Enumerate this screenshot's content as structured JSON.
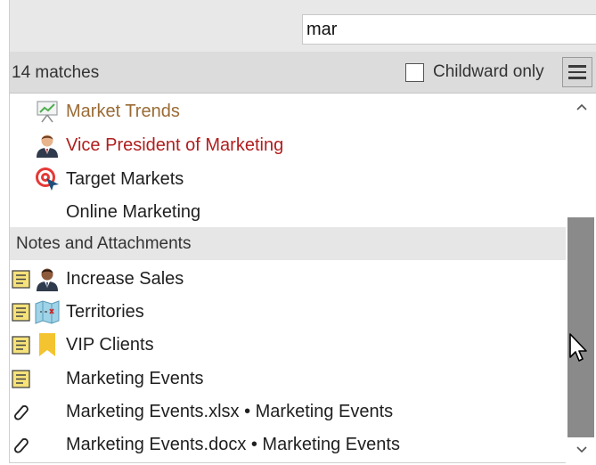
{
  "search": {
    "value": "mar"
  },
  "filter": {
    "matches": "14 matches",
    "childward_label": "Childward only",
    "childward_checked": false
  },
  "results": [
    {
      "label": "Market Trends",
      "color": "#9a6b35",
      "icon": "chart-presentation-icon"
    },
    {
      "label": "Vice President of Marketing",
      "color": "#b01e1e",
      "icon": "person-icon"
    },
    {
      "label": "Target Markets",
      "color": "#1f1f1f",
      "icon": "target-icon"
    },
    {
      "label": "Online Marketing",
      "color": "#1f1f1f",
      "icon": ""
    }
  ],
  "section": {
    "label": "Notes and Attachments"
  },
  "notes": [
    {
      "label": "Increase Sales",
      "lead_icon": "note-icon",
      "icon": "person-icon"
    },
    {
      "label": "Territories",
      "lead_icon": "note-icon",
      "icon": "map-icon"
    },
    {
      "label": "VIP Clients",
      "lead_icon": "note-icon",
      "icon": "bookmark-icon"
    },
    {
      "label": "Marketing Events",
      "lead_icon": "note-icon",
      "icon": ""
    },
    {
      "label": "Marketing Events.xlsx • Marketing Events",
      "lead_icon": "paperclip-icon",
      "icon": ""
    },
    {
      "label": "Marketing Events.docx • Marketing Events",
      "lead_icon": "paperclip-icon",
      "icon": ""
    }
  ]
}
